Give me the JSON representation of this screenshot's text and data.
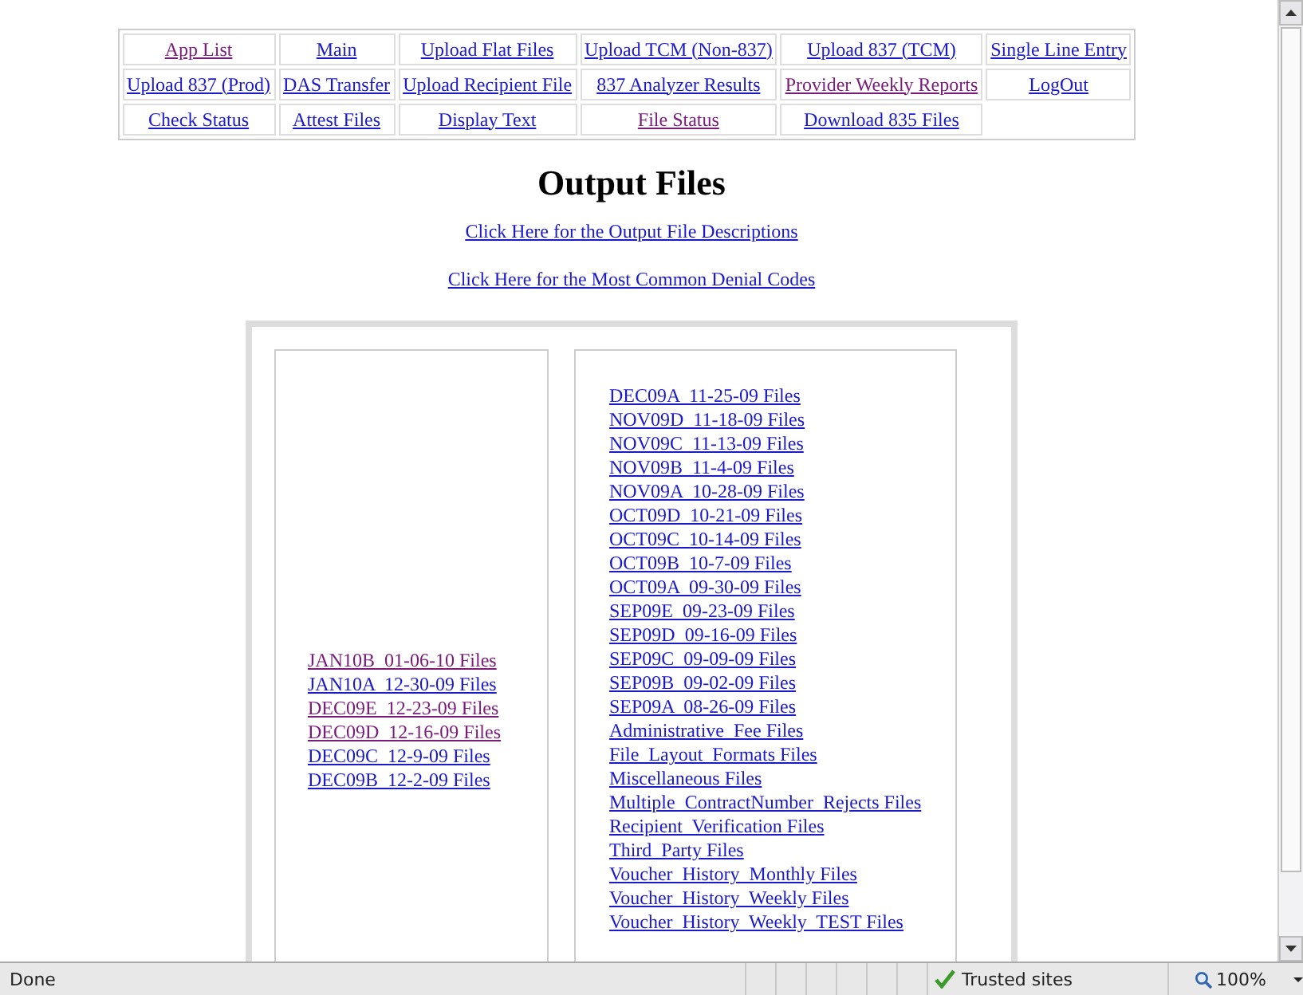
{
  "nav": [
    [
      {
        "label": "App List",
        "visited": true
      },
      {
        "label": "Main",
        "visited": false
      },
      {
        "label": "Upload Flat Files",
        "visited": false
      },
      {
        "label": "Upload TCM (Non-837)",
        "visited": false
      },
      {
        "label": "Upload 837 (TCM)",
        "visited": false
      },
      {
        "label": "Single Line Entry",
        "visited": false
      }
    ],
    [
      {
        "label": "Upload 837 (Prod)",
        "visited": false
      },
      {
        "label": "DAS Transfer",
        "visited": false
      },
      {
        "label": "Upload Recipient File",
        "visited": false
      },
      {
        "label": "837 Analyzer Results",
        "visited": false
      },
      {
        "label": "Provider Weekly Reports",
        "visited": true
      },
      {
        "label": "LogOut",
        "visited": false
      }
    ],
    [
      {
        "label": "Check Status",
        "visited": false
      },
      {
        "label": "Attest Files",
        "visited": false
      },
      {
        "label": "Display Text",
        "visited": false
      },
      {
        "label": "File Status",
        "visited": true
      },
      {
        "label": "Download 835 Files",
        "visited": false
      }
    ]
  ],
  "title": "Output Files",
  "links": [
    {
      "label": "Click Here for the Output File Descriptions",
      "visited": false
    },
    {
      "label": "Click Here for the Most Common Denial Codes",
      "visited": false
    }
  ],
  "left_files": [
    {
      "label": "JAN10B  01-06-10 Files",
      "visited": true
    },
    {
      "label": "JAN10A  12-30-09 Files",
      "visited": false
    },
    {
      "label": "DEC09E  12-23-09 Files",
      "visited": true
    },
    {
      "label": "DEC09D  12-16-09 Files",
      "visited": true
    },
    {
      "label": "DEC09C  12-9-09 Files",
      "visited": false
    },
    {
      "label": "DEC09B  12-2-09 Files",
      "visited": false
    }
  ],
  "right_files": [
    {
      "label": "DEC09A  11-25-09 Files",
      "visited": false
    },
    {
      "label": "NOV09D  11-18-09 Files",
      "visited": false
    },
    {
      "label": "NOV09C  11-13-09 Files",
      "visited": false
    },
    {
      "label": "NOV09B  11-4-09 Files",
      "visited": false
    },
    {
      "label": "NOV09A  10-28-09 Files",
      "visited": false
    },
    {
      "label": "OCT09D  10-21-09 Files",
      "visited": false
    },
    {
      "label": "OCT09C  10-14-09 Files",
      "visited": false
    },
    {
      "label": "OCT09B  10-7-09 Files",
      "visited": false
    },
    {
      "label": "OCT09A  09-30-09 Files",
      "visited": false
    },
    {
      "label": "SEP09E  09-23-09 Files",
      "visited": false
    },
    {
      "label": "SEP09D  09-16-09 Files",
      "visited": false
    },
    {
      "label": "SEP09C  09-09-09 Files",
      "visited": false
    },
    {
      "label": "SEP09B  09-02-09 Files",
      "visited": false
    },
    {
      "label": "SEP09A  08-26-09 Files",
      "visited": false
    },
    {
      "label": "Administrative  Fee Files",
      "visited": false
    },
    {
      "label": "File  Layout  Formats Files",
      "visited": false
    },
    {
      "label": "Miscellaneous Files",
      "visited": false
    },
    {
      "label": "Multiple  ContractNumber  Rejects Files",
      "visited": false
    },
    {
      "label": "Recipient  Verification Files",
      "visited": false
    },
    {
      "label": "Third  Party Files",
      "visited": false
    },
    {
      "label": "Voucher  History  Monthly Files",
      "visited": false
    },
    {
      "label": "Voucher  History  Weekly Files",
      "visited": false
    },
    {
      "label": "Voucher  History  Weekly  TEST Files",
      "visited": false
    }
  ],
  "status_bar": {
    "text": "Done",
    "zone": "Trusted sites",
    "zoom": "100%"
  }
}
